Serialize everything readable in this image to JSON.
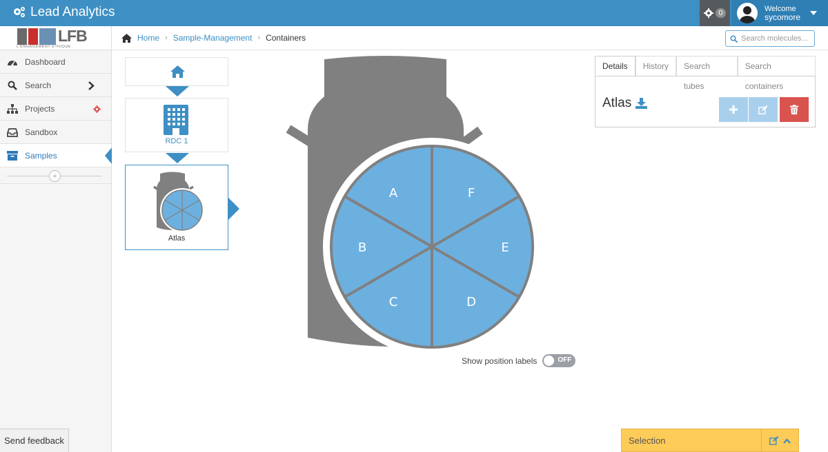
{
  "app": {
    "title": "Lead Analytics"
  },
  "header": {
    "notification_count": "0",
    "welcome_label": "Welcome",
    "username": "sycomore"
  },
  "logo": {
    "text": "LFB",
    "tagline": "L'ENGAGEMENT ÉTHIQUE"
  },
  "sidebar": {
    "items": [
      {
        "label": "Dashboard",
        "icon": "dashboard-icon"
      },
      {
        "label": "Search",
        "icon": "search-icon"
      },
      {
        "label": "Projects",
        "icon": "sitemap-icon"
      },
      {
        "label": "Sandbox",
        "icon": "inbox-icon"
      },
      {
        "label": "Samples",
        "icon": "archive-icon",
        "active": true
      }
    ],
    "collapse_glyph": "«",
    "feedback_label": "Send feedback"
  },
  "breadcrumb": {
    "items": [
      "Home",
      "Sample-Management",
      "Containers"
    ]
  },
  "search": {
    "placeholder": "Search molecules..."
  },
  "tree": {
    "level1_label": "RDC 1",
    "level2_label": "Atlas"
  },
  "container": {
    "positions": [
      "A",
      "F",
      "B",
      "E",
      "C",
      "D"
    ],
    "fill_color": "#6cb0e0",
    "body_color": "#808080"
  },
  "toggle": {
    "label": "Show position labels",
    "state": "OFF"
  },
  "details": {
    "tabs": [
      "Details",
      "History",
      "Search tubes",
      "Search containers"
    ],
    "title": "Atlas"
  },
  "selection": {
    "label": "Selection"
  },
  "colors": {
    "primary": "#3d8fc4",
    "danger": "#d9534f",
    "light_button": "#a8d0ec",
    "selection": "#fdcb58"
  }
}
